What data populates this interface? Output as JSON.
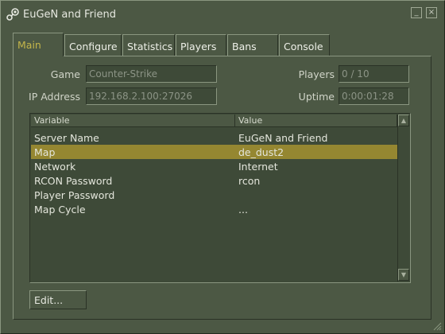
{
  "window": {
    "title": "EuGeN and Friend",
    "minimize_glyph": "_",
    "close_glyph": "×",
    "app_icon": "steam-icon"
  },
  "tabs": [
    {
      "label": "Main",
      "active": true
    },
    {
      "label": "Configure",
      "active": false
    },
    {
      "label": "Statistics",
      "active": false
    },
    {
      "label": "Players",
      "active": false
    },
    {
      "label": "Bans",
      "active": false
    },
    {
      "label": "Console",
      "active": false
    }
  ],
  "info": {
    "game_label": "Game",
    "game_value": "Counter-Strike",
    "ip_label": "IP Address",
    "ip_value": "192.168.2.100:27026",
    "players_label": "Players",
    "players_value": "0 / 10",
    "uptime_label": "Uptime",
    "uptime_value": "0:00:01:28"
  },
  "table": {
    "columns": [
      "Variable",
      "Value"
    ],
    "rows": [
      {
        "variable": "Server Name",
        "value": "EuGeN and Friend",
        "selected": false
      },
      {
        "variable": "Map",
        "value": "de_dust2",
        "selected": true
      },
      {
        "variable": "Network",
        "value": "Internet",
        "selected": false
      },
      {
        "variable": "RCON Password",
        "value": "rcon",
        "selected": false
      },
      {
        "variable": "Player Password",
        "value": "",
        "selected": false
      },
      {
        "variable": "Map Cycle",
        "value": "...",
        "selected": false
      }
    ]
  },
  "buttons": {
    "edit_label": "Edit..."
  },
  "colors": {
    "background": "#4c5844",
    "field_background": "#3e4a38",
    "selection": "#958731",
    "active_tab_text": "#c4b54a"
  }
}
